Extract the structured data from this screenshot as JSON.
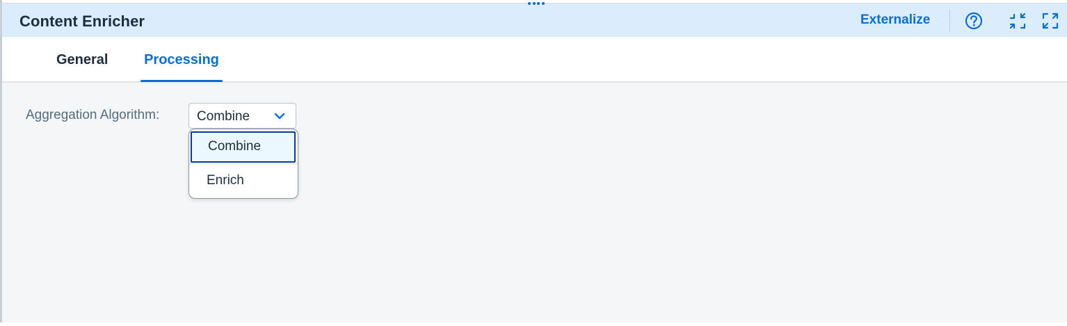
{
  "header": {
    "title": "Content Enricher",
    "externalize_label": "Externalize",
    "icons": [
      "help-icon",
      "exit-fullscreen-icon",
      "enter-fullscreen-icon"
    ]
  },
  "tabs": [
    {
      "label": "General",
      "selected": false
    },
    {
      "label": "Processing",
      "selected": true
    }
  ],
  "form": {
    "aggregation_label": "Aggregation Algorithm:",
    "aggregation_value": "Combine",
    "options": [
      "Combine",
      "Enrich"
    ]
  },
  "colors": {
    "accent": "#0a6ed1",
    "header_bg": "#dbecfc",
    "text": "#1d2d3e",
    "label": "#556b82",
    "content_bg": "#f5f6f7"
  }
}
